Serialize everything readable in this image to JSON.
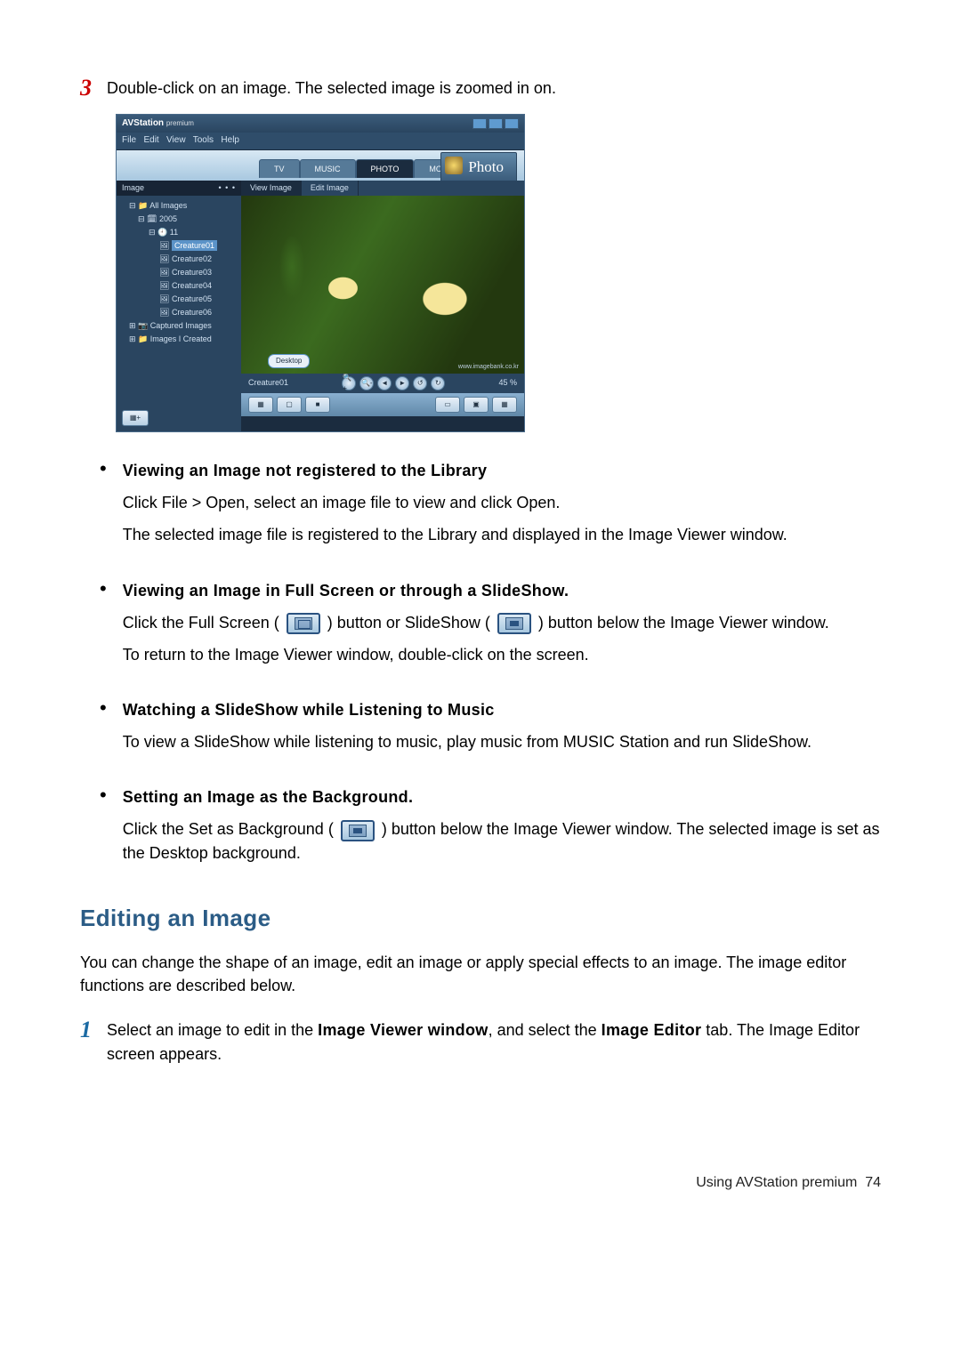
{
  "step_top": {
    "num": "3",
    "text": "Double-click on an image. The selected image is zoomed in on."
  },
  "screenshot": {
    "title_app": "AVStation",
    "title_suffix": "premium",
    "menu_items": [
      "File",
      "Edit",
      "View",
      "Tools",
      "Help"
    ],
    "tabs": [
      "TV",
      "MUSIC",
      "PHOTO",
      "MOVIE"
    ],
    "photo_badge": "Photo",
    "side_panel_title": "Image",
    "tree": {
      "root": "All Images",
      "year": "2005",
      "month": "11",
      "items": [
        "Creature01",
        "Creature02",
        "Creature03",
        "Creature04",
        "Creature05",
        "Creature06"
      ],
      "captured": "Captured Images",
      "created": "Images I Created"
    },
    "subtabs": [
      "View Image",
      "Edit Image"
    ],
    "balloon": "Desktop",
    "watermark": "www.imagebank.co.kr",
    "status_name": "Creature01",
    "status_pct": "45 %",
    "round_icons": [
      "🔍+",
      "🔍-",
      "◄",
      "►",
      "↺",
      "↻"
    ],
    "bottom_left_icons": [
      "▦",
      "▢",
      "■"
    ],
    "bottom_right_icons": [
      "▭",
      "▣",
      "▦"
    ],
    "side_btn": "▦+"
  },
  "bullets": [
    {
      "title": "Viewing an Image not registered to the Library",
      "paras": [
        "Click File  >  Open, select an image file to view and click Open.",
        "The selected image file is registered to the Library and displayed in the Image Viewer window."
      ]
    },
    {
      "title": "Viewing an Image in Full Screen or through a SlideShow.",
      "rich_before": "Click the Full Screen (",
      "rich_mid": ") button or SlideShow (",
      "rich_after": ") button below the Image Viewer window.",
      "para2": "To return to the Image Viewer window, double-click on the screen."
    },
    {
      "title": "Watching a SlideShow while Listening to Music",
      "paras": [
        "To view a SlideShow while listening to music, play music from MUSIC Station and run SlideShow."
      ]
    },
    {
      "title": "Setting an Image as the Background.",
      "rich_before": "Click the Set as Background (",
      "rich_after": ") button below the Image Viewer window. The selected image is set as the Desktop background."
    }
  ],
  "section_heading": "Editing an Image",
  "section_intro": "You can change the shape of an image, edit an image or apply special effects to an image. The image editor functions are described below.",
  "step_bottom": {
    "num": "1",
    "text_before": "Select an image to edit in the ",
    "bold1": "Image Viewer window",
    "mid": ", and select the ",
    "bold2": "Image Editor",
    "after": " tab. The Image Editor screen appears."
  },
  "footer": {
    "label": "Using AVStation premium",
    "page": "74"
  }
}
